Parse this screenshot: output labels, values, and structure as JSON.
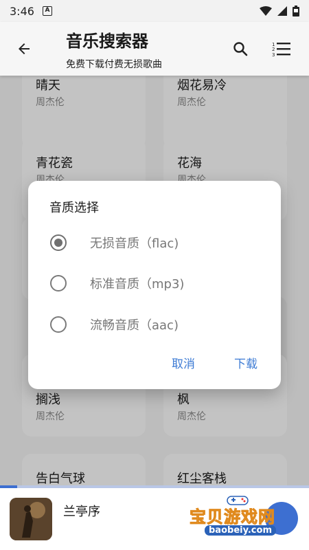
{
  "status_bar": {
    "time": "3:46",
    "notification_badge": "A"
  },
  "app_bar": {
    "title": "音乐搜索器",
    "subtitle": "免费下载付费无损歌曲"
  },
  "songs": [
    {
      "title": "晴天",
      "artist": "周杰伦"
    },
    {
      "title": "烟花易冷",
      "artist": "周杰伦"
    },
    {
      "title": "青花瓷",
      "artist": "周杰伦"
    },
    {
      "title": "花海",
      "artist": "周杰伦"
    },
    {
      "title": "搁浅",
      "artist": "周杰伦"
    },
    {
      "title": "枫",
      "artist": "周杰伦"
    },
    {
      "title": "告白气球",
      "artist": ""
    },
    {
      "title": "红尘客栈",
      "artist": ""
    }
  ],
  "dialog": {
    "title": "音质选择",
    "options": [
      {
        "label": "无损音质（flac)",
        "selected": true
      },
      {
        "label": "标准音质（mp3)",
        "selected": false
      },
      {
        "label": "流畅音质（aac)",
        "selected": false
      }
    ],
    "cancel_label": "取消",
    "confirm_label": "下载"
  },
  "player": {
    "now_playing": "兰亭序",
    "progress": 0.055
  },
  "watermark": {
    "main": "宝贝游戏网",
    "sub": "baobeiy.com"
  },
  "colors": {
    "accent": "#3d7bd4",
    "player_accent": "#3d6fd1"
  }
}
